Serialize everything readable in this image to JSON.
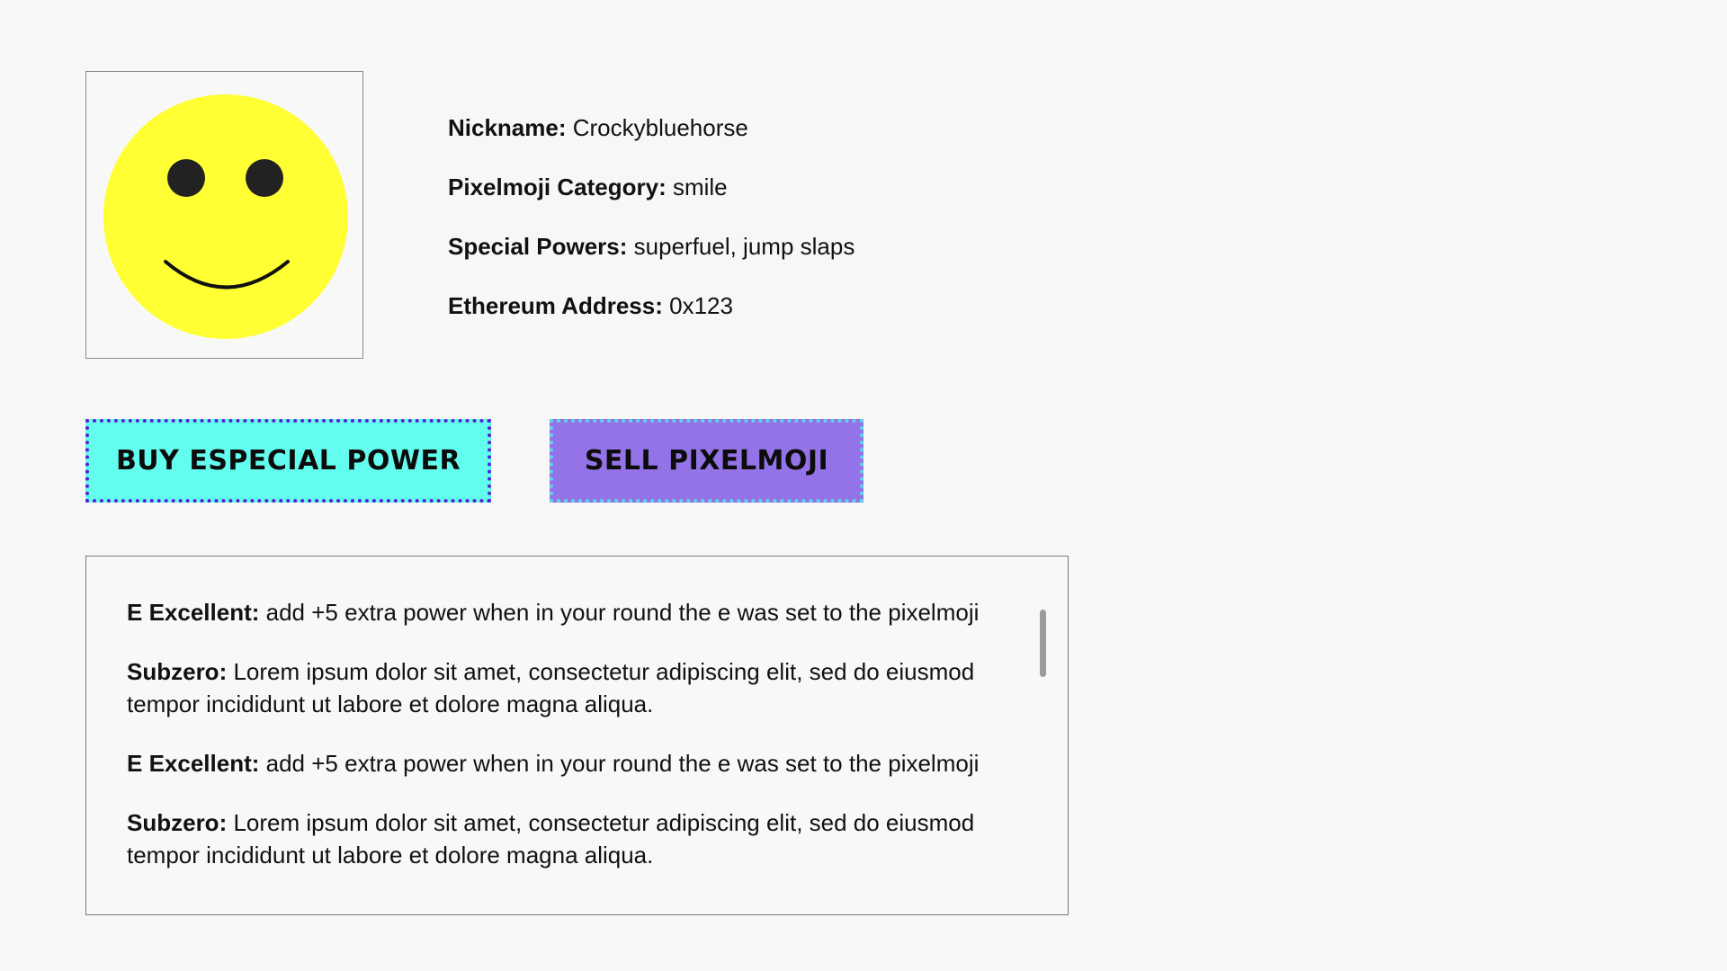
{
  "profile": {
    "avatar_icon": "smiley-face-icon",
    "details": [
      {
        "label": "Nickname:",
        "value": "Crockybluehorse"
      },
      {
        "label": "Pixelmoji Category:",
        "value": "smile"
      },
      {
        "label": "Special Powers:",
        "value": "superfuel, jump slaps"
      },
      {
        "label": "Ethereum Address:",
        "value": "0x123"
      }
    ]
  },
  "actions": {
    "buy_label": "BUY ESPECIAL POWER",
    "sell_label": "SELL PIXELMOJI"
  },
  "powers": [
    {
      "name": "E Excellent:",
      "description": "add +5 extra power when in your round the e was set to the pixelmoji"
    },
    {
      "name": "Subzero:",
      "description": "Lorem ipsum dolor sit amet, consectetur adipiscing elit, sed do eiusmod tempor incididunt ut labore et dolore magna aliqua."
    },
    {
      "name": "E Excellent:",
      "description": "add +5 extra power when in your round the e was set to the pixelmoji"
    },
    {
      "name": "Subzero:",
      "description": "Lorem ipsum dolor sit amet, consectetur adipiscing elit, sed do eiusmod tempor incididunt ut labore et dolore magna aliqua."
    }
  ],
  "colors": {
    "background": "#f7f7f7",
    "buy_button": "#62fdee",
    "buy_border": "#5a1fd6",
    "sell_button": "#9473e8",
    "sell_border": "#5cd6e6",
    "smiley_face": "#ffff33",
    "smiley_features": "#222222"
  }
}
